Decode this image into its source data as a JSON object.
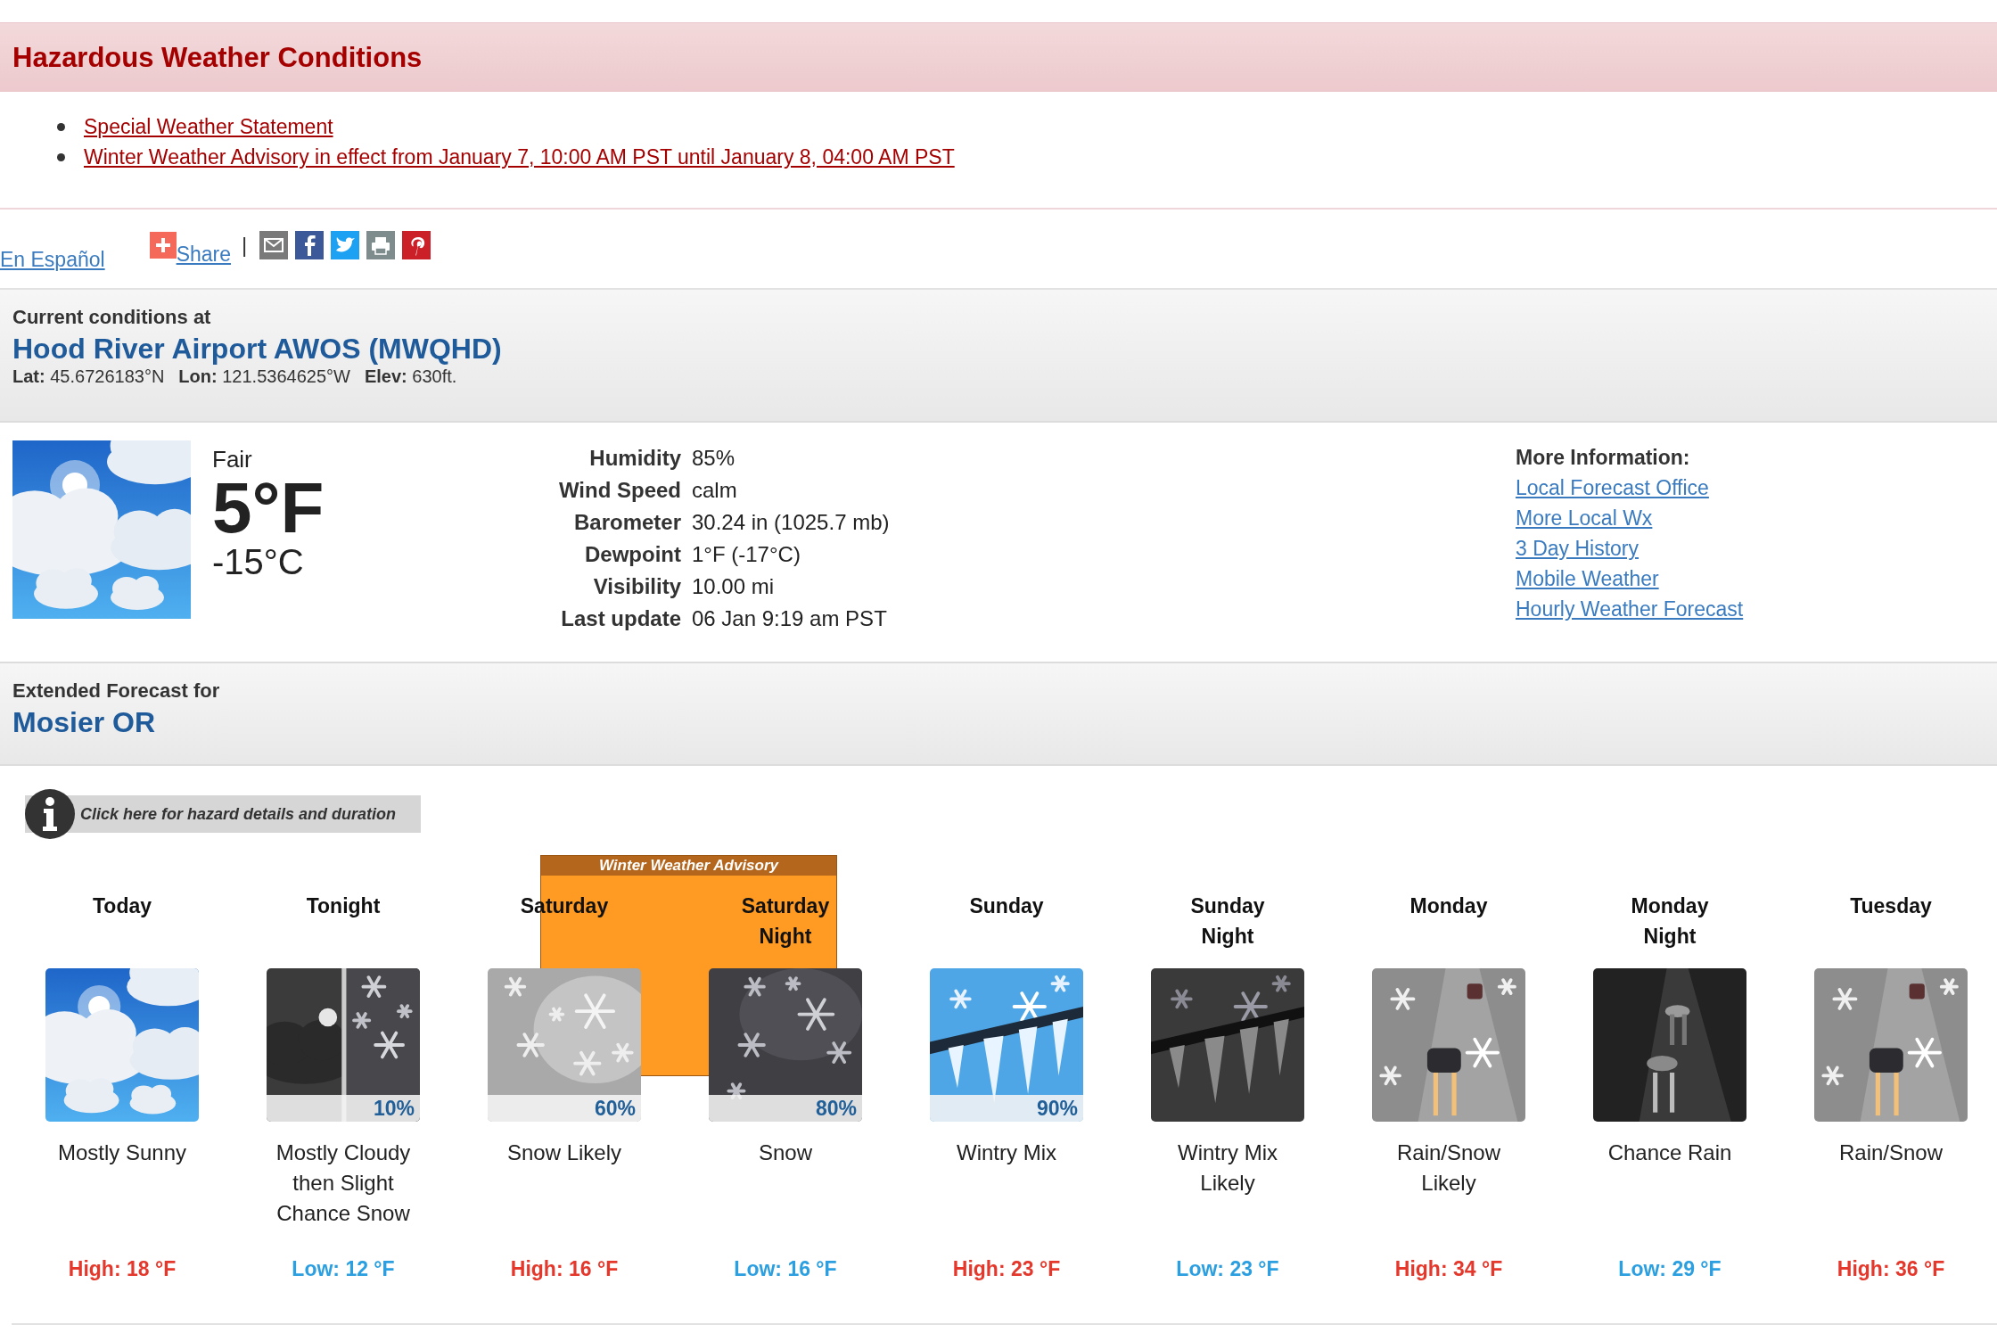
{
  "hazards": {
    "title": "Hazardous Weather Conditions",
    "items": [
      "Special Weather Statement",
      "Winter Weather Advisory in effect from January 7, 10:00 AM PST until January 8, 04:00 AM PST"
    ]
  },
  "share_bar": {
    "language_link": "En Español",
    "share_label": "Share",
    "separator": "|",
    "icons": [
      {
        "kind": "email"
      },
      {
        "kind": "facebook"
      },
      {
        "kind": "twitter"
      },
      {
        "kind": "print"
      },
      {
        "kind": "pinterest"
      }
    ]
  },
  "current": {
    "heading": "Current conditions at",
    "station": "Hood River Airport AWOS (MWQHD)",
    "coords": [
      {
        "label": "Lat:",
        "value": "45.6726183°N"
      },
      {
        "label": "Lon:",
        "value": "121.5364625°W"
      },
      {
        "label": "Elev:",
        "value": "630ft."
      }
    ],
    "picture": {
      "kind": "sunny"
    },
    "summary": "Fair",
    "temp_f": "5°F",
    "temp_c": "-15°C",
    "details": [
      {
        "label": "Humidity",
        "value": "85%"
      },
      {
        "label": "Wind Speed",
        "value": "calm"
      },
      {
        "label": "Barometer",
        "value": "30.24 in (1025.7 mb)"
      },
      {
        "label": "Dewpoint",
        "value": "1°F (-17°C)"
      },
      {
        "label": "Visibility",
        "value": "10.00 mi"
      },
      {
        "label": "Last update",
        "value": "06 Jan 9:19 am PST"
      }
    ],
    "more_info": {
      "title": "More Information:",
      "links": [
        "Local Forecast Office",
        "More Local Wx",
        "3 Day History",
        "Mobile Weather",
        "Hourly Weather Forecast"
      ]
    }
  },
  "extended": {
    "heading": "Extended Forecast for",
    "location": "Mosier OR",
    "hazard_button": "Click here for hazard details and duration",
    "advisory_label": "Winter Weather Advisory",
    "periods": [
      {
        "name": "Today",
        "picture": {
          "kind": "sunny"
        },
        "desc": "Mostly Sunny",
        "temp": {
          "kind": "high",
          "text": "High: 18 °F"
        },
        "advisory": false
      },
      {
        "name": "Tonight",
        "picture": {
          "kind": "night-snow"
        },
        "chance": "10%",
        "desc": "Mostly Cloudy then Slight Chance Snow",
        "temp": {
          "kind": "low",
          "text": "Low: 12 °F"
        },
        "advisory": false
      },
      {
        "name": "Saturday",
        "picture": {
          "kind": "snow-light"
        },
        "chance": "60%",
        "desc": "Snow Likely",
        "temp": {
          "kind": "high",
          "text": "High: 16 °F"
        },
        "advisory": true
      },
      {
        "name": "Saturday Night",
        "picture": {
          "kind": "snow-dark"
        },
        "chance": "80%",
        "desc": "Snow",
        "temp": {
          "kind": "low",
          "text": "Low: 16 °F"
        },
        "advisory": true
      },
      {
        "name": "Sunday",
        "picture": {
          "kind": "ice-light"
        },
        "chance": "90%",
        "desc": "Wintry Mix",
        "temp": {
          "kind": "high",
          "text": "High: 23 °F"
        },
        "advisory": false
      },
      {
        "name": "Sunday Night",
        "picture": {
          "kind": "ice-dark"
        },
        "desc": "Wintry Mix Likely",
        "temp": {
          "kind": "low",
          "text": "Low: 23 °F"
        },
        "advisory": false
      },
      {
        "name": "Monday",
        "picture": {
          "kind": "road-snow"
        },
        "desc": "Rain/Snow Likely",
        "temp": {
          "kind": "high",
          "text": "High: 34 °F"
        },
        "advisory": false
      },
      {
        "name": "Monday Night",
        "picture": {
          "kind": "road-night"
        },
        "desc": "Chance Rain",
        "temp": {
          "kind": "low",
          "text": "Low: 29 °F"
        },
        "advisory": false
      },
      {
        "name": "Tuesday",
        "picture": {
          "kind": "road-snow"
        },
        "desc": "Rain/Snow",
        "temp": {
          "kind": "high",
          "text": "High: 36 °F"
        },
        "advisory": false
      }
    ]
  }
}
